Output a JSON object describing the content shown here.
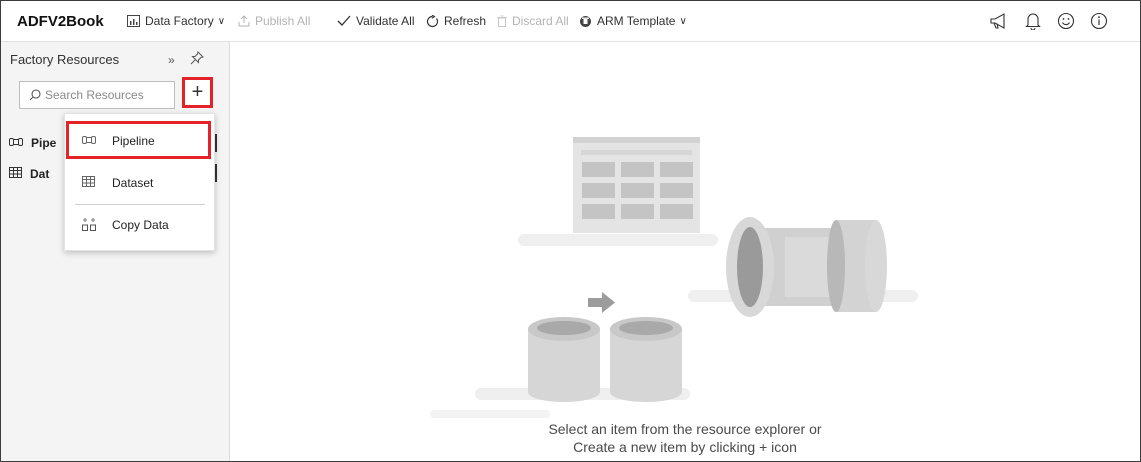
{
  "topbar": {
    "factory_name": "ADFV2Book",
    "data_factory_label": "Data Factory",
    "publish_all_label": "Publish All",
    "validate_all_label": "Validate All",
    "refresh_label": "Refresh",
    "discard_all_label": "Discard All",
    "arm_template_label": "ARM Template",
    "right_icons": [
      "megaphone-icon",
      "bell-icon",
      "smiley-icon",
      "info-icon"
    ]
  },
  "sidebar": {
    "title": "Factory Resources",
    "search": {
      "placeholder": "Search Resources",
      "value": ""
    },
    "add_label": "+",
    "tree": [
      {
        "label": "Pipe",
        "icon": "pipeline-icon"
      },
      {
        "label": "Dat",
        "icon": "dataset-icon"
      }
    ]
  },
  "new_menu": {
    "items": [
      {
        "label": "Pipeline",
        "icon": "pipeline-icon"
      },
      {
        "label": "Dataset",
        "icon": "dataset-icon"
      },
      {
        "label": "Copy Data",
        "icon": "copy-data-icon"
      }
    ]
  },
  "canvas": {
    "hint_line1": "Select an item from the resource explorer or",
    "hint_line2": "Create a new item by clicking + icon"
  },
  "colors": {
    "accent_highlight": "#e3222a",
    "disabled_text": "#b3b3b3",
    "illustration_gray": "#c8c8c8"
  }
}
